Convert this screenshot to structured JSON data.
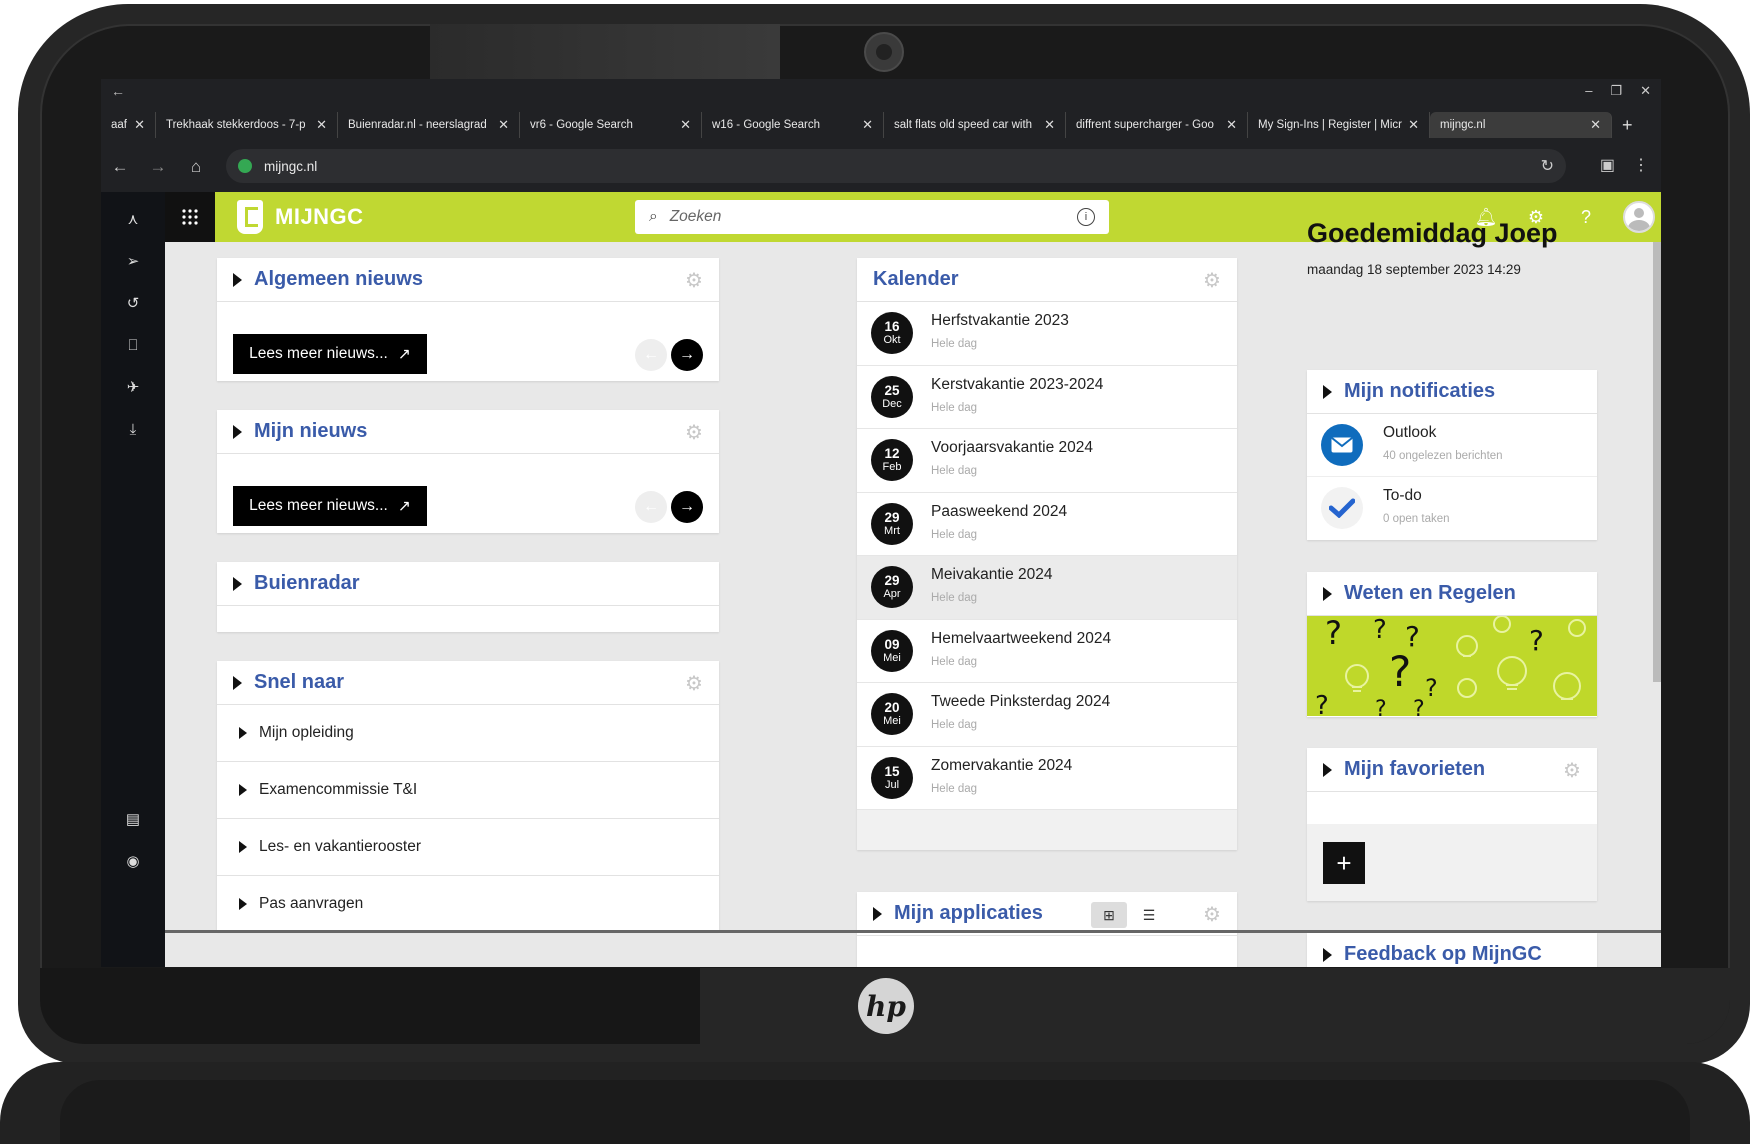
{
  "browser": {
    "tabs": [
      {
        "label": "aaf",
        "active": false
      },
      {
        "label": "Trekhaak stekkerdoos - 7-p",
        "active": false
      },
      {
        "label": "Buienradar.nl - neerslagrad",
        "active": false
      },
      {
        "label": "vr6 - Google Search",
        "active": false
      },
      {
        "label": "w16 - Google Search",
        "active": false
      },
      {
        "label": "salt flats old speed car with",
        "active": false
      },
      {
        "label": "diffrent supercharger - Goo",
        "active": false
      },
      {
        "label": "My Sign-Ins | Register | Micr",
        "active": false
      },
      {
        "label": "mijngc.nl",
        "active": true
      }
    ],
    "url": "mijngc.nl"
  },
  "header": {
    "logo_text": "MIJNGC",
    "search_placeholder": "Zoeken",
    "accent_color": "#c0d832"
  },
  "news": {
    "algemeen_title": "Algemeen nieuws",
    "mijn_title": "Mijn nieuws",
    "read_more": "Lees meer nieuws..."
  },
  "buienradar": {
    "title": "Buienradar"
  },
  "snel": {
    "title": "Snel naar",
    "items": [
      "Mijn opleiding",
      "Examencommissie T&I",
      "Les- en vakantierooster",
      "Pas aanvragen"
    ]
  },
  "calendar": {
    "title": "Kalender",
    "items": [
      {
        "day": "16",
        "month": "Okt",
        "name": "Herfstvakantie 2023",
        "sub": "Hele dag"
      },
      {
        "day": "25",
        "month": "Dec",
        "name": "Kerstvakantie 2023-2024",
        "sub": "Hele dag"
      },
      {
        "day": "12",
        "month": "Feb",
        "name": "Voorjaarsvakantie 2024",
        "sub": "Hele dag"
      },
      {
        "day": "29",
        "month": "Mrt",
        "name": "Paasweekend 2024",
        "sub": "Hele dag"
      },
      {
        "day": "29",
        "month": "Apr",
        "name": "Meivakantie 2024",
        "sub": "Hele dag"
      },
      {
        "day": "09",
        "month": "Mei",
        "name": "Hemelvaartweekend 2024",
        "sub": "Hele dag"
      },
      {
        "day": "20",
        "month": "Mei",
        "name": "Tweede Pinksterdag 2024",
        "sub": "Hele dag"
      },
      {
        "day": "15",
        "month": "Jul",
        "name": "Zomervakantie 2024",
        "sub": "Hele dag"
      }
    ]
  },
  "apps": {
    "title": "Mijn applicaties"
  },
  "greeting": {
    "title": "Goedemiddag Joep",
    "date": "maandag 18 september 2023 14:29"
  },
  "notifications": {
    "title": "Mijn notificaties",
    "items": [
      {
        "name": "Outlook",
        "sub": "40 ongelezen berichten"
      },
      {
        "name": "To-do",
        "sub": "0 open taken"
      }
    ]
  },
  "weten": {
    "title": "Weten en Regelen"
  },
  "favorieten": {
    "title": "Mijn favorieten"
  },
  "feedback": {
    "title": "Feedback op MijnGC"
  },
  "device": {
    "brand": "hp"
  }
}
